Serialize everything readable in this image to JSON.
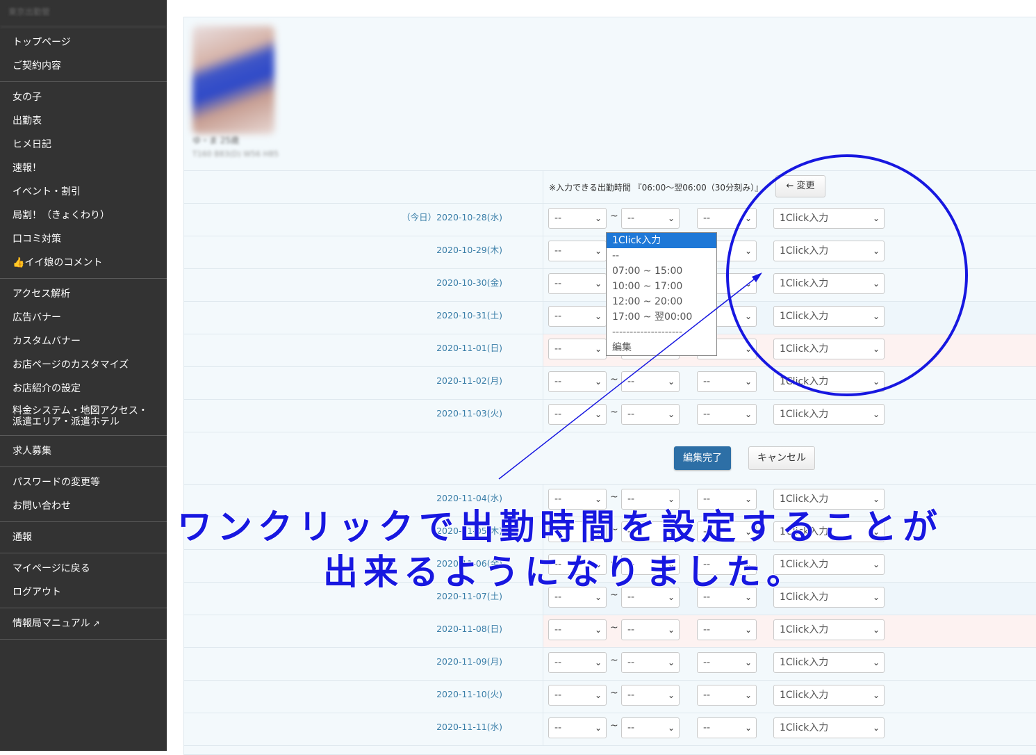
{
  "sidebar": {
    "brand": "東京出勤管",
    "groups": [
      [
        "トップページ",
        "ご契約内容"
      ],
      [
        "女の子",
        "出勤表",
        "ヒメ日記",
        "速報！",
        "イベント・割引",
        "局割！（きょくわり）",
        "口コミ対策",
        "👍イイ娘のコメント"
      ],
      [
        "アクセス解析",
        "広告バナー",
        "カスタムバナー",
        "お店ページのカスタマイズ",
        "お店紹介の設定",
        "料金システム・地図アクセス・派遣エリア・派遣ホテル"
      ],
      [
        "求人募集"
      ],
      [
        "パスワードの変更等",
        "お問い合わせ"
      ],
      [
        "通報"
      ],
      [
        "マイページに戻る",
        "ログアウト"
      ],
      [
        "情報局マニュアル"
      ]
    ]
  },
  "profile": {
    "name": "ゆ・ま 25歳",
    "info": "T160 B83(D) W56 H85"
  },
  "hint": "※入力できる出勤時間 『06:00〜翌06:00（30分刻み）』",
  "change_button": "← 変更",
  "select_placeholder": "--",
  "tilde": "~",
  "oneclick_label": "1Click入力",
  "rows_top": [
    {
      "date": "（今日）2020-10-28(水)",
      "type": "today"
    },
    {
      "date": "2020-10-29(木)",
      "type": "weekday"
    },
    {
      "date": "2020-10-30(金)",
      "type": "weekday"
    },
    {
      "date": "2020-10-31(土)",
      "type": "sat"
    },
    {
      "date": "2020-11-01(日)",
      "type": "sun"
    },
    {
      "date": "2020-11-02(月)",
      "type": "weekday"
    },
    {
      "date": "2020-11-03(火)",
      "type": "weekday"
    }
  ],
  "rows_bottom": [
    {
      "date": "2020-11-04(水)",
      "type": "weekday"
    },
    {
      "date": "2020-11-05(木)",
      "type": "weekday"
    },
    {
      "date": "2020-11-06(金)",
      "type": "weekday"
    },
    {
      "date": "2020-11-07(土)",
      "type": "sat"
    },
    {
      "date": "2020-11-08(日)",
      "type": "sun"
    },
    {
      "date": "2020-11-09(月)",
      "type": "weekday"
    },
    {
      "date": "2020-11-10(火)",
      "type": "weekday"
    },
    {
      "date": "2020-11-11(水)",
      "type": "weekday"
    }
  ],
  "buttons": {
    "done": "編集完了",
    "cancel": "キャンセル"
  },
  "dropdown": {
    "options": [
      "1Click入力",
      "--",
      "07:00 ~ 15:00",
      "10:00 ~ 17:00",
      "12:00 ~ 20:00",
      "17:00 ~ 翌00:00",
      "--------------------",
      "編集"
    ],
    "selected": "1Click入力"
  },
  "annotation": {
    "line1": "ワンクリックで出勤時間を設定することが",
    "line2": "出来るようになりました。",
    "color": "#1717e0"
  },
  "colors": {
    "sidebar_bg": "#333333",
    "accent": "#2d6fa6",
    "sunday_bg": "#fdf2f1",
    "date_text": "#3a7ea8"
  }
}
